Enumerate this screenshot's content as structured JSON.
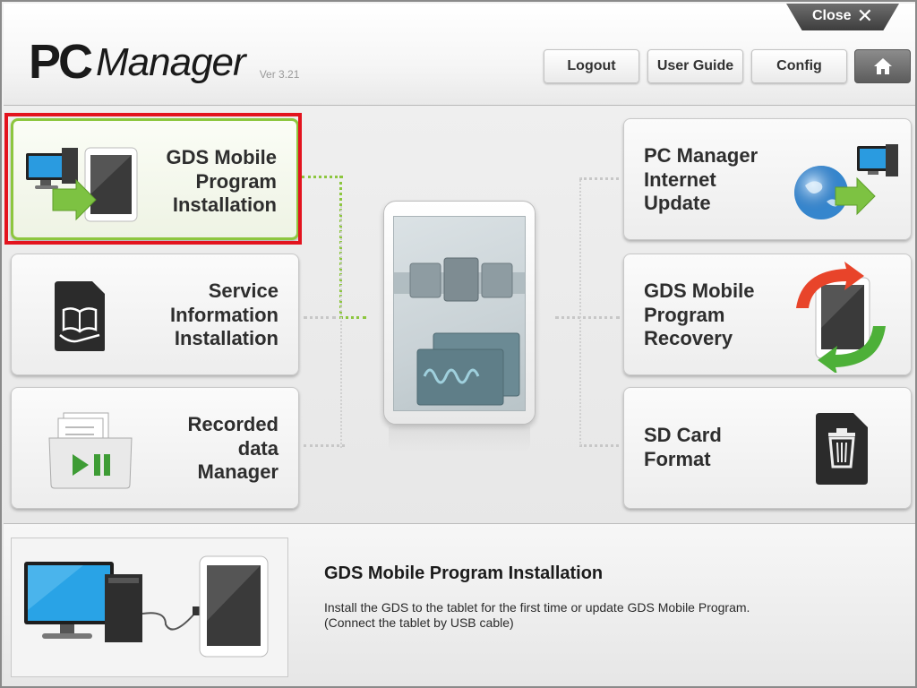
{
  "app": {
    "logo_pc": "PC",
    "logo_manager": "Manager",
    "version": "Ver 3.21",
    "close_label": "Close",
    "close_glyph": "✕"
  },
  "header_buttons": {
    "logout": "Logout",
    "user_guide": "User Guide",
    "config": "Config",
    "home_icon": "home-icon"
  },
  "tiles": {
    "gds_install": {
      "label": "GDS Mobile\nProgram\nInstallation",
      "icon": "pc-to-tablet-icon",
      "selected": true
    },
    "service_info": {
      "label": "Service\nInformation\nInstallation",
      "icon": "sd-card-book-icon"
    },
    "recorded_data": {
      "label": "Recorded\ndata\nManager",
      "icon": "folder-play-icon"
    },
    "internet_update": {
      "label": "PC Manager\nInternet\nUpdate",
      "icon": "globe-to-pc-icon"
    },
    "program_recovery": {
      "label": "GDS Mobile\nProgram\nRecovery",
      "icon": "tablet-refresh-icon"
    },
    "sd_format": {
      "label": "SD Card\nFormat",
      "icon": "sd-card-trash-icon"
    }
  },
  "description": {
    "title": "GDS Mobile Program Installation",
    "line1": "Install the GDS to the tablet for the first time or update GDS Mobile Program.",
    "line2": "(Connect the tablet by USB cable)"
  },
  "colors": {
    "selection_red": "#e3131e",
    "selection_green": "#8dc63f",
    "arrow_green": "#7dc242"
  }
}
